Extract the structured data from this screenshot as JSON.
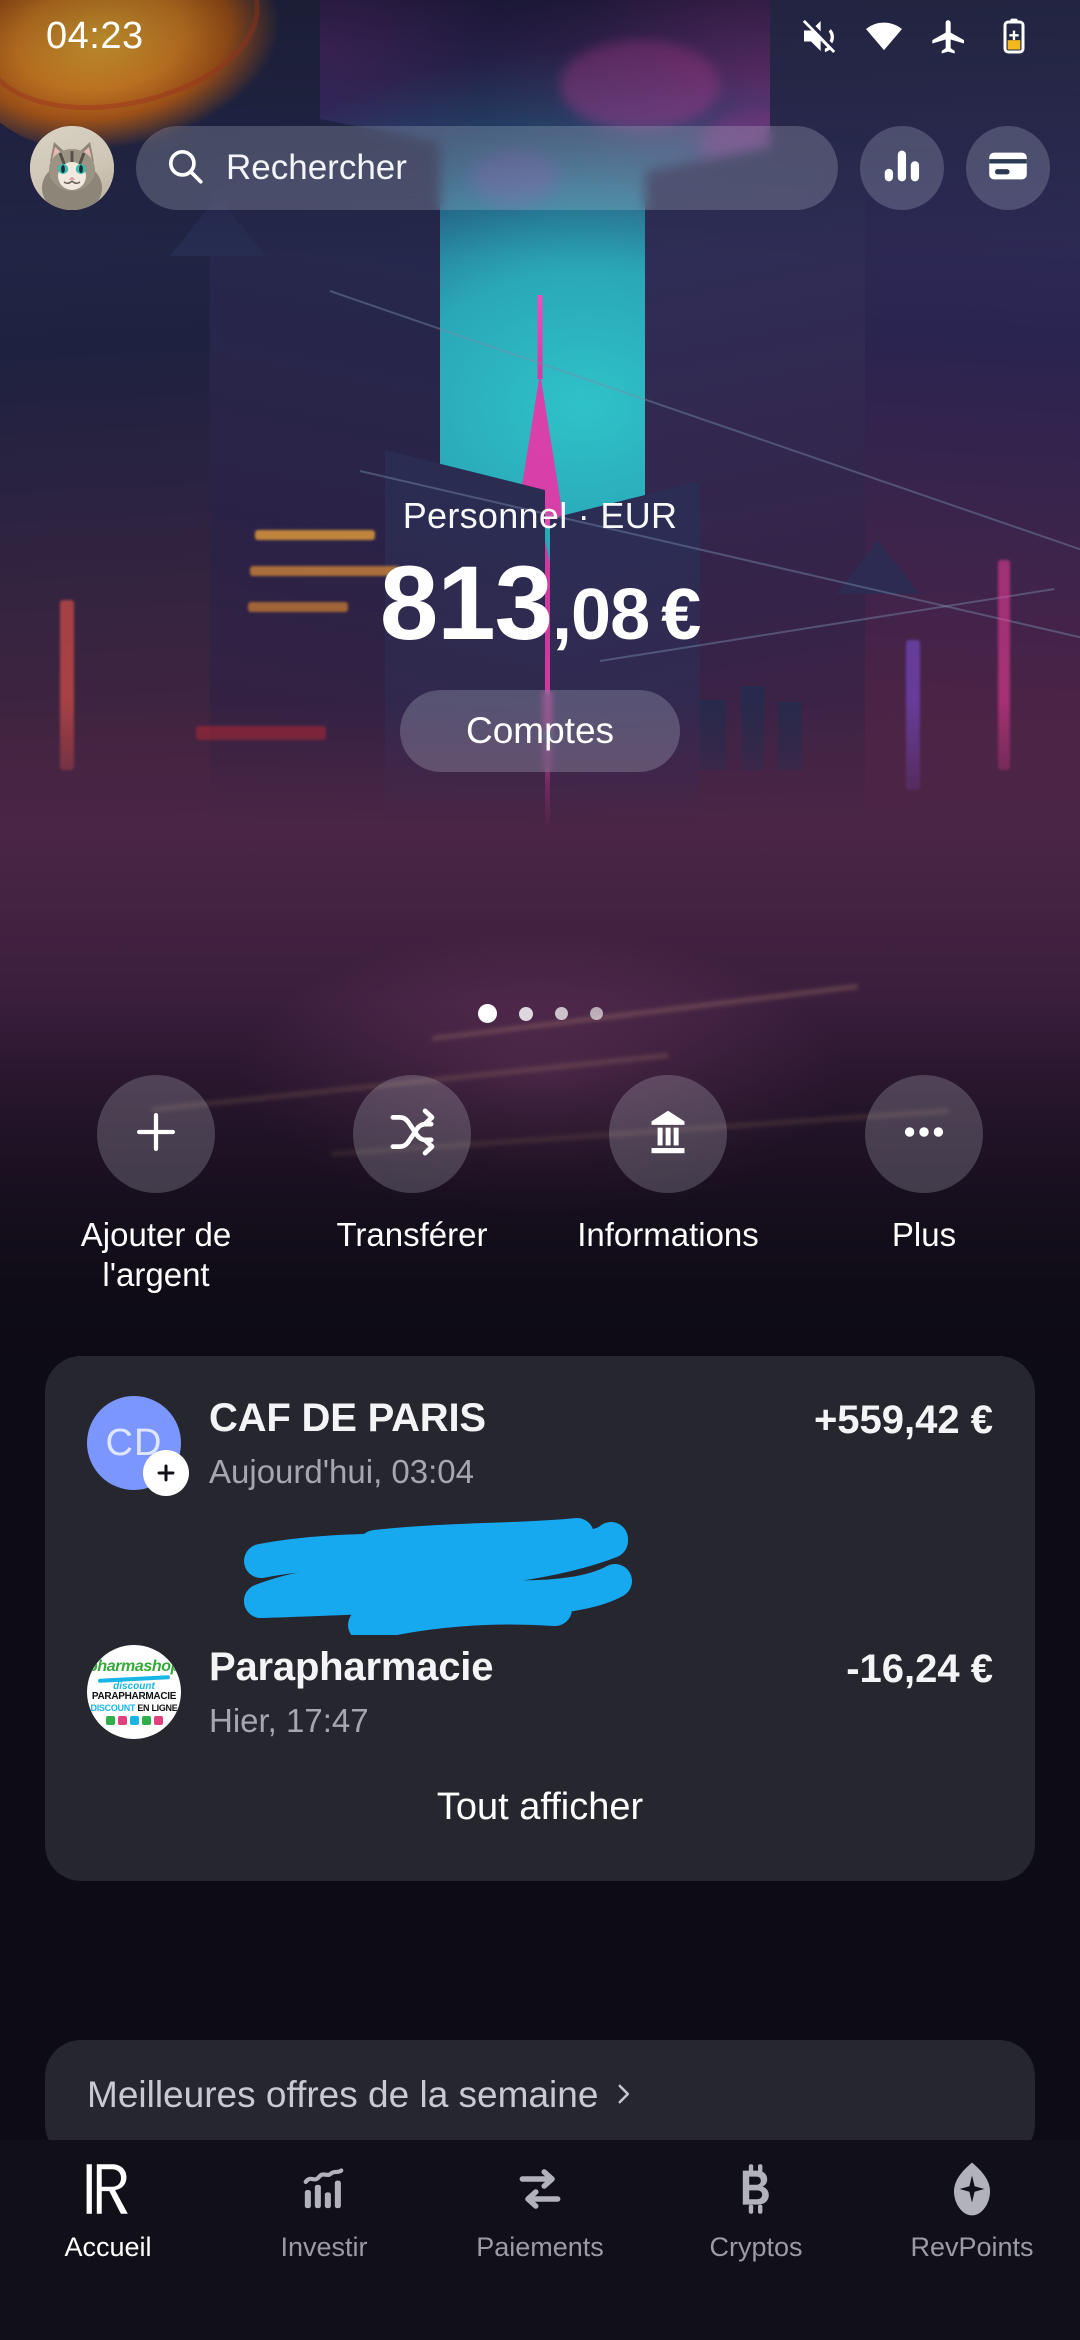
{
  "status_bar": {
    "time": "04:23",
    "icons": [
      "sound-off-icon",
      "wifi-icon",
      "airplane-mode-icon",
      "battery-saver-icon"
    ]
  },
  "header": {
    "avatar_name": "cat-avatar",
    "search": {
      "placeholder": "Rechercher",
      "icon": "search-icon"
    },
    "analytics_button": {
      "icon": "analytics-bars-icon"
    },
    "cards_button": {
      "icon": "credit-card-icon"
    }
  },
  "balance": {
    "account_label": "Personnel · EUR",
    "amount_integer": "813",
    "amount_decimal": ",08",
    "currency_symbol": "€",
    "accounts_button": "Comptes",
    "pager": {
      "total": 4,
      "active_index": 0
    }
  },
  "actions": [
    {
      "label": "Ajouter de l'argent",
      "icon": "plus-icon"
    },
    {
      "label": "Transférer",
      "icon": "shuffle-arrows-icon"
    },
    {
      "label": "Informations",
      "icon": "bank-building-icon"
    },
    {
      "label": "Plus",
      "icon": "ellipsis-icon"
    }
  ],
  "transactions": {
    "items": [
      {
        "name": "CAF DE PARIS",
        "subtitle": "Aujourd'hui, 03:04",
        "amount": "+559,42 €",
        "avatar_type": "initials",
        "initials": "CD",
        "badge": "plus-icon",
        "redacted": true
      },
      {
        "name": "Parapharmacie",
        "subtitle": "Hier, 17:47",
        "amount": "-16,24 €",
        "avatar_type": "logo",
        "logo": {
          "line1": "pharmashop",
          "line2": "discount",
          "line3": "PARAPHARMACIE",
          "line4_a": "DISCOUNT",
          "line4_b": "EN LIGNE"
        }
      }
    ],
    "show_all_label": "Tout afficher"
  },
  "offers": {
    "title": "Meilleures offres de la semaine",
    "chevron": "chevron-right-icon"
  },
  "bottom_nav": [
    {
      "label": "Accueil",
      "icon": "revolut-r-icon",
      "active": true
    },
    {
      "label": "Investir",
      "icon": "investing-chart-icon",
      "active": false
    },
    {
      "label": "Paiements",
      "icon": "transfer-arrows-icon",
      "active": false
    },
    {
      "label": "Cryptos",
      "icon": "bitcoin-icon",
      "active": false
    },
    {
      "label": "RevPoints",
      "icon": "revpoints-diamond-icon",
      "active": false
    }
  ],
  "colors": {
    "card_bg": "#26262f",
    "page_bg": "#0d0b14",
    "nav_bg": "#110f18",
    "accent_avatar": "#7b97ff",
    "redaction": "#17a9f0",
    "text_primary": "#f4f4f6",
    "text_secondary": "#a6a6ae"
  }
}
